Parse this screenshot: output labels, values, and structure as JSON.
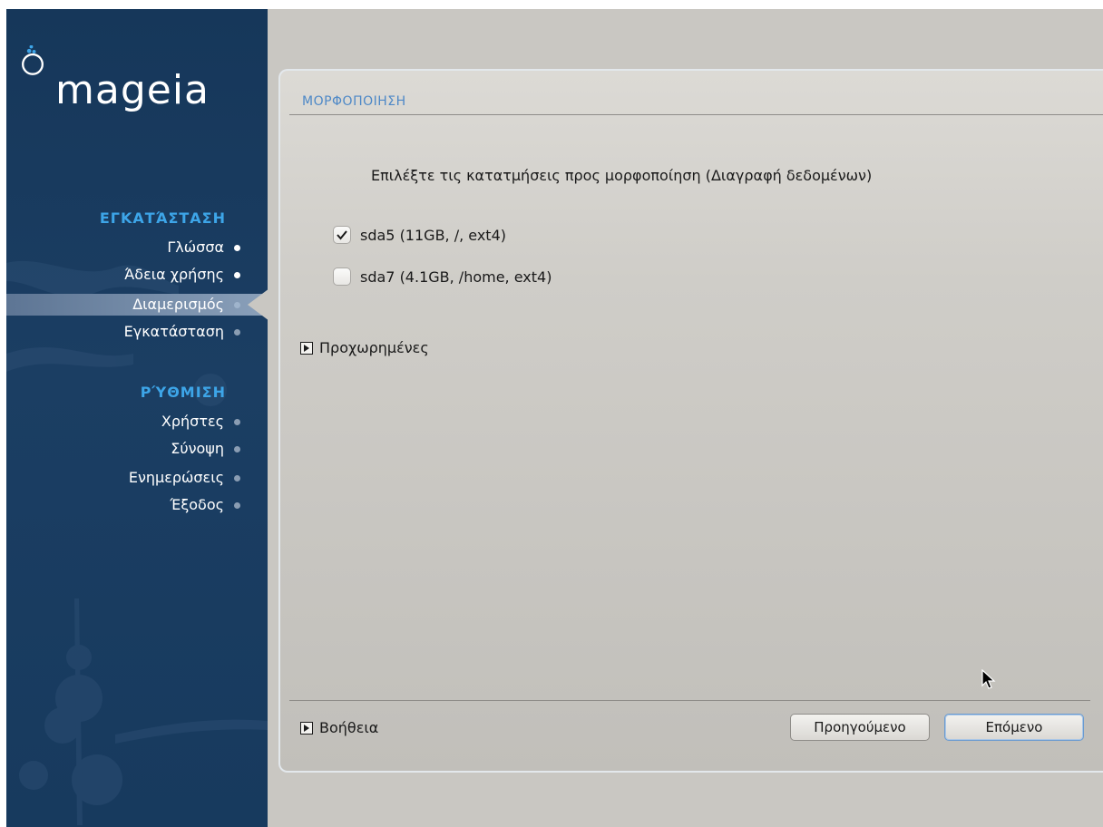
{
  "brand": {
    "name": "mageia"
  },
  "sidebar": {
    "sections": [
      {
        "title": "ΕΓΚΑΤΆΣΤΑΣΗ",
        "items": [
          {
            "label": "Γλώσσα",
            "state": "done"
          },
          {
            "label": "Άδεια χρήσης",
            "state": "done"
          },
          {
            "label": "Διαμερισμός",
            "state": "active"
          },
          {
            "label": "Εγκατάσταση",
            "state": "pending"
          }
        ]
      },
      {
        "title": "ΡΎΘΜΙΣΗ",
        "items": [
          {
            "label": "Χρήστες",
            "state": "pending"
          },
          {
            "label": "Σύνοψη",
            "state": "pending"
          },
          {
            "label": "Ενημερώσεις",
            "state": "pending"
          },
          {
            "label": "Έξοδος",
            "state": "pending"
          }
        ]
      }
    ]
  },
  "panel": {
    "title": "ΜΟΡΦΟΠΟΙΗΣΗ",
    "instruction": "Επιλέξτε τις κατατμήσεις προς μορφοποίηση (Διαγραφή δεδομένων)",
    "partitions": [
      {
        "label": "sda5 (11GB, /, ext4)",
        "checked": true
      },
      {
        "label": "sda7 (4.1GB, /home, ext4)",
        "checked": false
      }
    ],
    "advanced_label": "Προχωρημένες",
    "help_label": "Βοήθεια",
    "buttons": {
      "previous": "Προηγούμενο",
      "next": "Επόμενο"
    }
  },
  "colors": {
    "sidebar_bg": "#16375a",
    "section_title": "#3da5e8",
    "panel_title": "#4d88c7",
    "desktop_bg": "#c9c7c2"
  }
}
